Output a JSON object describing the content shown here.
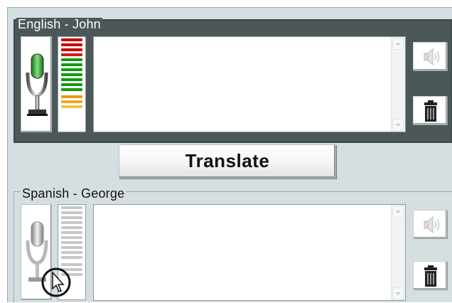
{
  "top_panel": {
    "legend": "English - John",
    "text": "",
    "meter_colors": [
      "#cc0000",
      "#cc0000",
      "#cc0000",
      "#d11a1a",
      "#119a11",
      "#119a11",
      "#119a11",
      "#119a11",
      "#119a11",
      "#119a11",
      "#119a11",
      "#f0a820",
      "#f0a820",
      "#f0c04a"
    ],
    "mic_state": "active"
  },
  "translate_button": {
    "label": "Translate"
  },
  "bottom_panel": {
    "legend": "Spanish - George",
    "text": "",
    "mic_state": "inactive"
  },
  "icons": {
    "mic": "microphone-icon",
    "speaker": "speaker-icon",
    "trash": "trash-icon"
  }
}
